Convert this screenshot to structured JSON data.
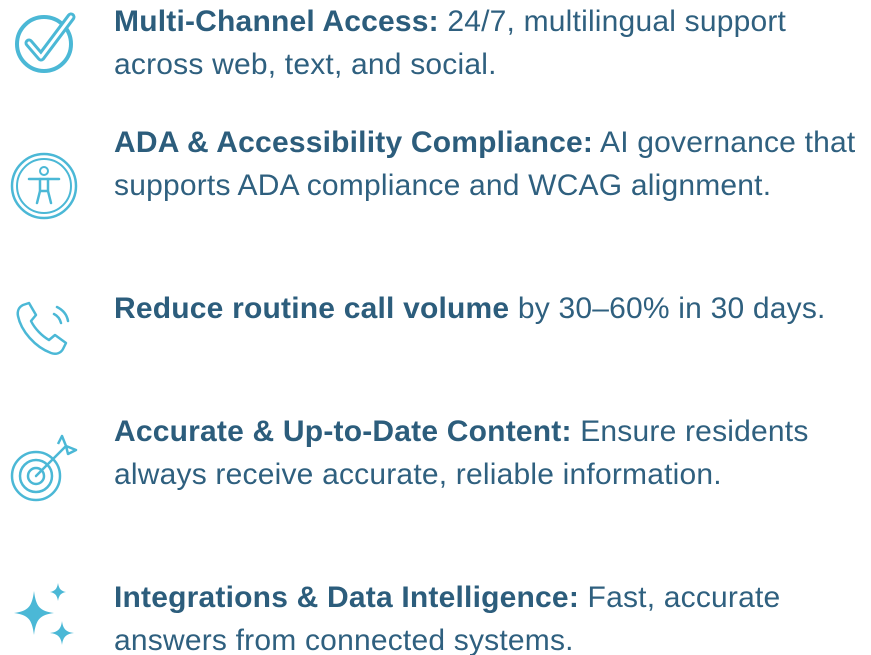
{
  "features": [
    {
      "icon": "checkmark-circle-icon",
      "bold": "Multi-Channel Access:",
      "rest": " 24/7, multilingual support across web, text, and social."
    },
    {
      "icon": "accessibility-person-icon",
      "bold": "ADA & Accessibility Compliance:",
      "rest": " AI governance that supports ADA compliance and WCAG alignment."
    },
    {
      "icon": "phone-call-icon",
      "bold": "Reduce routine call volume",
      "rest": " by 30–60% in 30 days."
    },
    {
      "icon": "target-arrow-icon",
      "bold": "Accurate & Up-to-Date Content:",
      "rest": " Ensure residents always receive accurate, reliable information."
    },
    {
      "icon": "sparkles-icon",
      "bold": "Integrations & Data Intelligence:",
      "rest": " Fast, accurate answers from connected systems."
    }
  ],
  "colors": {
    "icon_accent": "#4bb8d6",
    "heading_text": "#2c5d7c",
    "body_text": "#2f607f"
  }
}
